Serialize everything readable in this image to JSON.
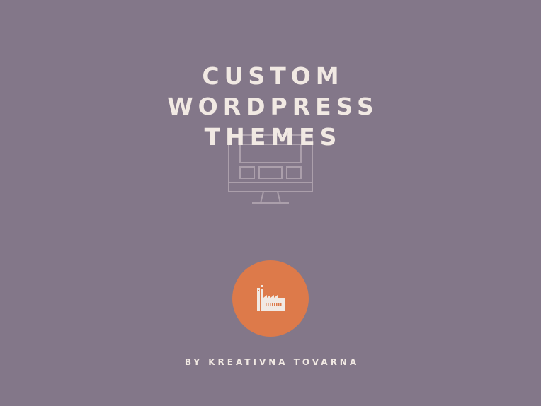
{
  "hero": {
    "title_lines": [
      "CUSTOM",
      "WORDPRESS",
      "THEMES"
    ],
    "background_color": "#837789",
    "text_color": "#f1e9e3",
    "monitor_icon": "desktop-monitor-icon"
  },
  "logo": {
    "icon": "factory-icon",
    "circle_color": "#dd7a4a"
  },
  "byline": {
    "text": "BY KREATIVNA TOVARNA"
  }
}
